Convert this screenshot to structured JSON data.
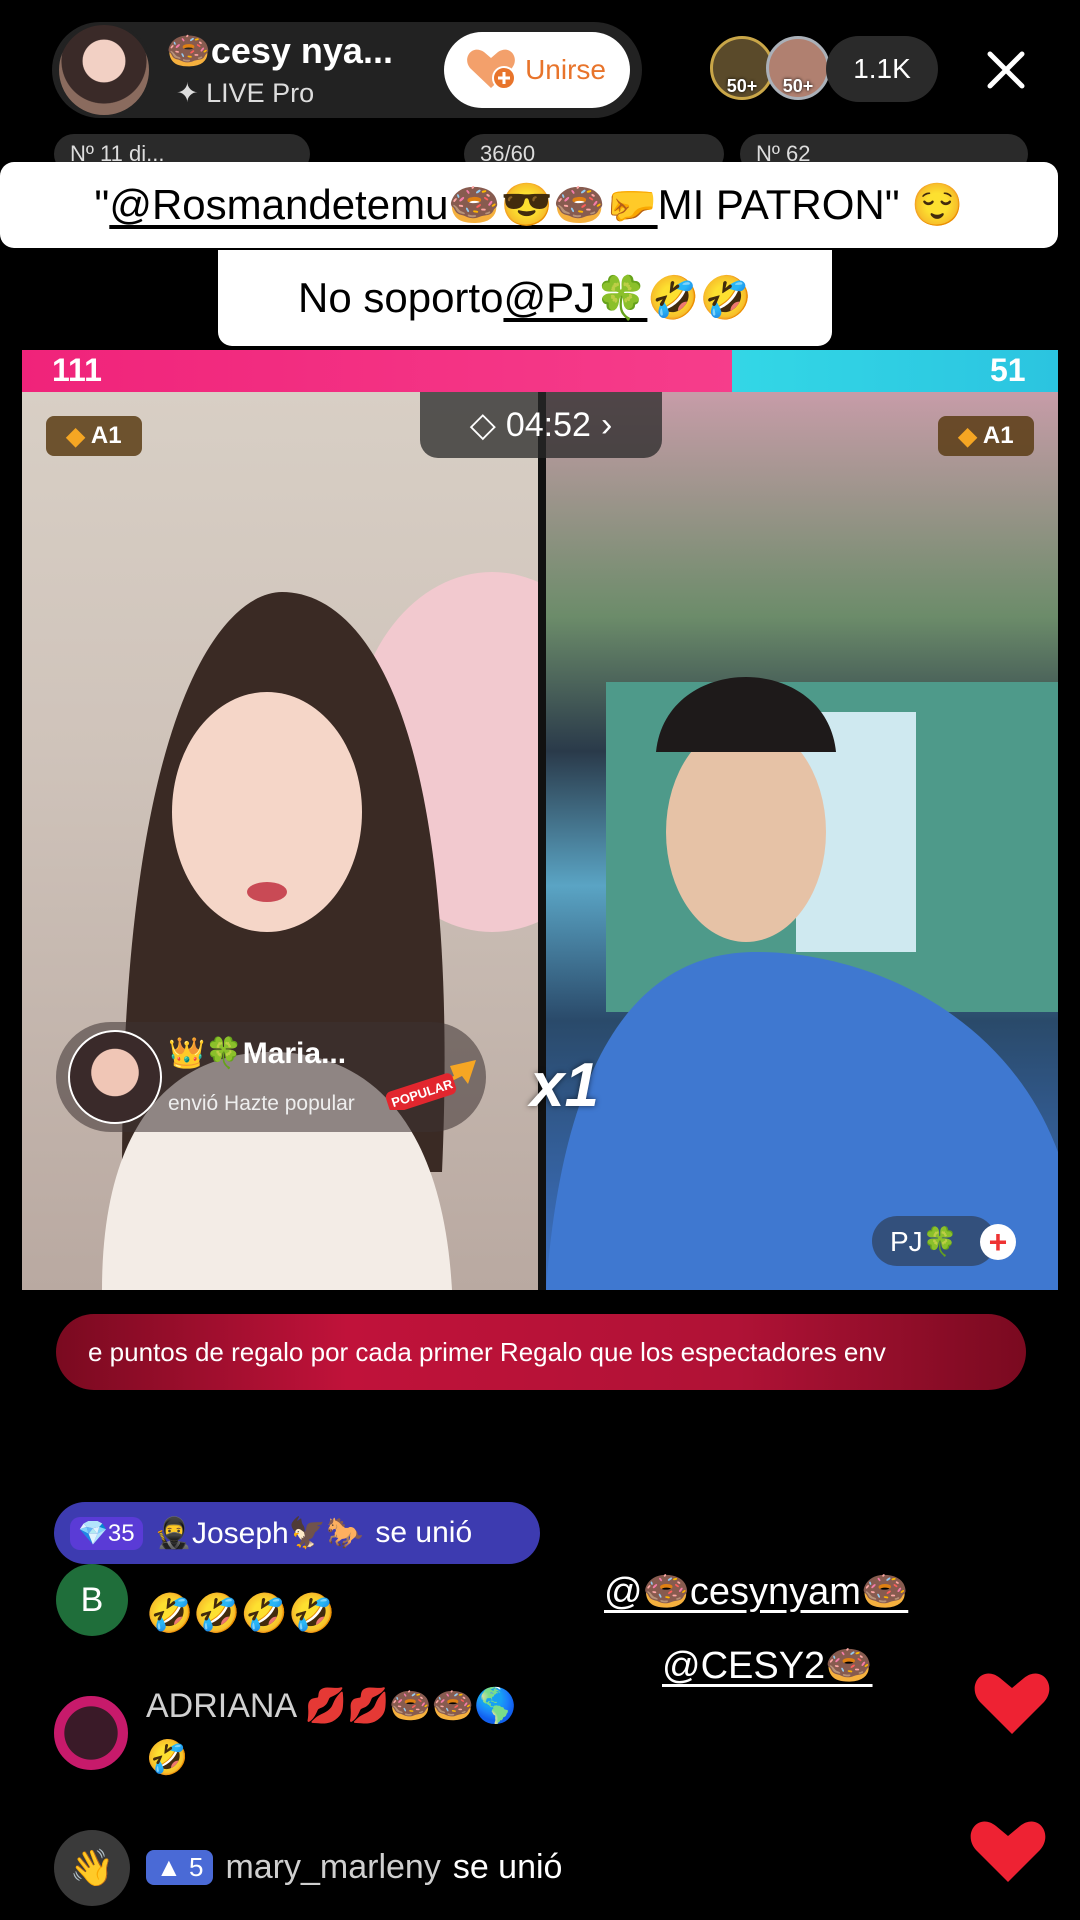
{
  "header": {
    "host_name": "🍩cesy nya...",
    "host_subtitle": "LIVE Pro",
    "join_label": "Unirse",
    "viewer_badges": [
      "50+",
      "50+"
    ],
    "viewer_count": "1.1K"
  },
  "chips": [
    "Nº 11 di...",
    "36/60",
    "Nº 62"
  ],
  "captions": {
    "line1_prefix": "\"",
    "line1_mention": "@Rosmandetemu🍩😎🍩🤛",
    "line1_suffix": " MI PATRON\" 😌",
    "line2_prefix": "No soporto ",
    "line2_mention": "@PJ🍀",
    "line2_suffix": "  🤣🤣"
  },
  "battle": {
    "left_score": "111",
    "right_score": "51",
    "left_fraction": 0.685,
    "timer": "04:52",
    "left_rank": "A1",
    "right_rank": "A1",
    "combo": "x1",
    "guest_name": "PJ🍀"
  },
  "gift": {
    "sender": "👑🍀Maria...",
    "text": "envió Hazte popular",
    "badge_text": "POPULAR"
  },
  "banner_text": "e puntos de regalo por cada primer Regalo que los espectadores env",
  "chat": {
    "joined": {
      "level": "35",
      "user": "🥷Joseph🦅🐎",
      "action": "se unió"
    },
    "msg1": {
      "avatar_letter": "B",
      "text": "🤣🤣🤣🤣"
    },
    "msg2": {
      "user": "ADRIANA 💋💋🍩🍩🌎",
      "text": "🤣"
    },
    "msg3": {
      "level": "5",
      "user": "mary_marleny",
      "action": "se unió"
    }
  },
  "mentions": [
    "@🍩cesynyam🍩",
    "@CESY2🍩"
  ],
  "colors": {
    "team_left": "#f0237a",
    "team_right": "#33d7e6",
    "accent": "#e8742b",
    "heart": "#ee2233"
  }
}
